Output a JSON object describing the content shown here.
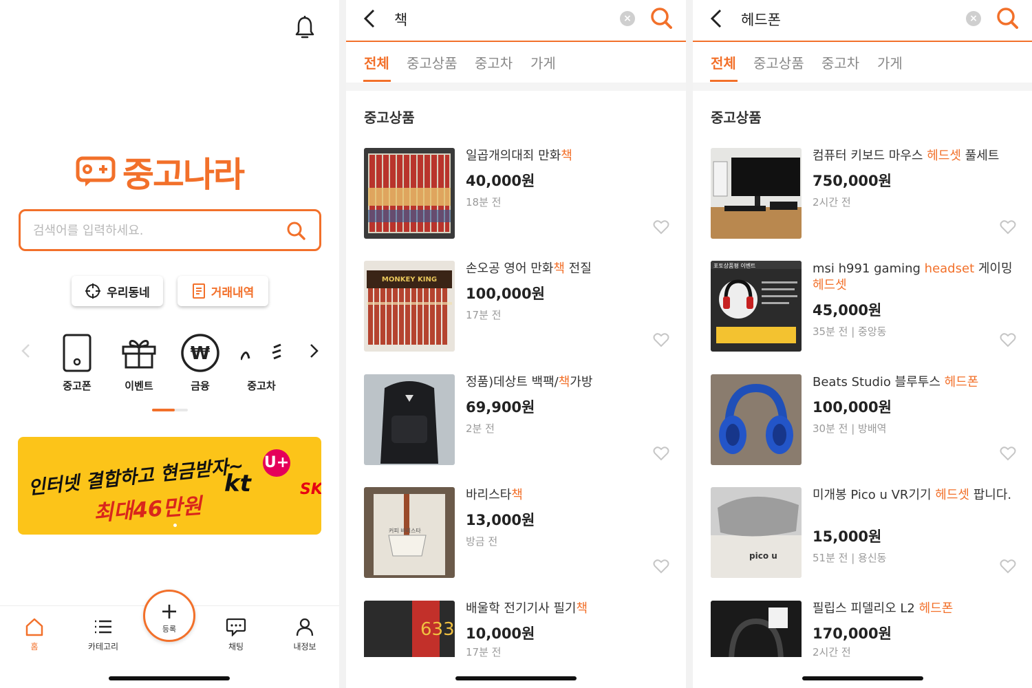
{
  "colors": {
    "accent": "#f2702a",
    "muted": "#9a9a9a",
    "banner": "#fcc419"
  },
  "home": {
    "logo_text": "중고나라",
    "search": {
      "placeholder": "검색어를 입력하세요."
    },
    "quick_buttons": {
      "town": "우리동네",
      "deals": "거래내역"
    },
    "categories": [
      {
        "label": "중고폰",
        "icon": "phone-icon"
      },
      {
        "label": "이벤트",
        "icon": "gift-icon"
      },
      {
        "label": "금융",
        "icon": "won-coin-icon"
      },
      {
        "label": "중고차",
        "icon": "car-icon"
      }
    ],
    "banner": {
      "line1": "인터넷 결합하고 현금받자~",
      "line2": "최대46만원",
      "kt": "kt",
      "u": "U+",
      "sk": "SK"
    },
    "tabbar": {
      "home": "홈",
      "category": "카테고리",
      "register": "등록",
      "chat": "채팅",
      "my": "내정보"
    }
  },
  "search_books": {
    "query": "책",
    "tabs": [
      "전체",
      "중고상품",
      "중고차",
      "가게"
    ],
    "section_title": "중고상품",
    "items": [
      {
        "pre": "일곱개의대죄 만화",
        "hl": "책",
        "post": "",
        "price": "40,000원",
        "meta": "18분 전"
      },
      {
        "pre": "손오공 영어 만화",
        "hl": "책",
        "post": " 전질",
        "price": "100,000원",
        "meta": "17분 전"
      },
      {
        "pre": "정품)데상트 백팩/",
        "hl": "책",
        "post": "가방",
        "price": "69,900원",
        "meta": "2분 전"
      },
      {
        "pre": "바리스타",
        "hl": "책",
        "post": "",
        "price": "13,000원",
        "meta": "방금 전"
      },
      {
        "pre": "배울학 전기기사 필기",
        "hl": "책",
        "post": "",
        "price": "10,000원",
        "meta": "17분 전"
      }
    ]
  },
  "search_headphones": {
    "query": "헤드폰",
    "tabs": [
      "전체",
      "중고상품",
      "중고차",
      "가게"
    ],
    "section_title": "중고상품",
    "items": [
      {
        "pre": "컴퓨터 키보드 마우스 ",
        "hl": "헤드셋",
        "post": " 풀세트",
        "price": "750,000원",
        "meta": "2시간 전"
      },
      {
        "pre": "msi h991 gaming ",
        "hl": "headset",
        "mid": " 게이밍",
        "hl2": "헤드셋",
        "price": "45,000원",
        "meta": "35분 전 | 중앙동"
      },
      {
        "pre": "Beats Studio 블루투스 ",
        "hl": "헤드폰",
        "post": "",
        "price": "100,000원",
        "meta": "30분 전 | 방배역"
      },
      {
        "pre": "미개봉 Pico u VR기기 ",
        "hl": "헤드셋",
        "post": " 팝니다.",
        "price": "15,000원",
        "meta": "51분 전 | 용신동"
      },
      {
        "pre": "필립스 피델리오 L2 ",
        "hl": "헤드폰",
        "post": "",
        "price": "170,000원",
        "meta": "2시간 전"
      }
    ]
  }
}
